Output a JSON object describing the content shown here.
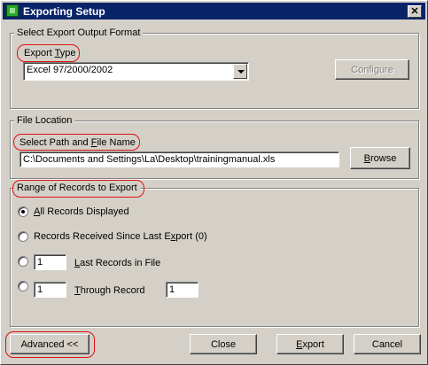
{
  "window": {
    "title": "Exporting Setup",
    "close_glyph": "✕"
  },
  "export_format": {
    "group_label": "Select Export Output Format",
    "type_label": "Export Type",
    "type_label_accel": "T",
    "selected_value": "Excel 97/2000/2002",
    "configure_button": "Configure"
  },
  "file_location": {
    "group_label": "File Location",
    "path_label": "Select Path and File Name",
    "path_value": "C:\\Documents and Settings\\La\\Desktop\\trainingmanual.xls",
    "browse_button": "Browse"
  },
  "range": {
    "group_label": "Range of Records to Export",
    "option_all": "All Records Displayed",
    "option_since": "Records Received Since Last Export (0)",
    "last_value": "1",
    "last_label": "Last Records in File",
    "from_value": "1",
    "through_label": "Through Record",
    "to_value": "1",
    "selected": "all"
  },
  "buttons": {
    "advanced": "Advanced <<",
    "close": "Close",
    "export": "Export",
    "cancel": "Cancel"
  },
  "accent_colors": {
    "titlebar": "#0a246a",
    "annotation": "#e01010",
    "face": "#d4d0c8"
  },
  "icons": {
    "app": "green-app-icon",
    "close": "close-x-icon",
    "dropdown": "chevron-down-icon"
  }
}
